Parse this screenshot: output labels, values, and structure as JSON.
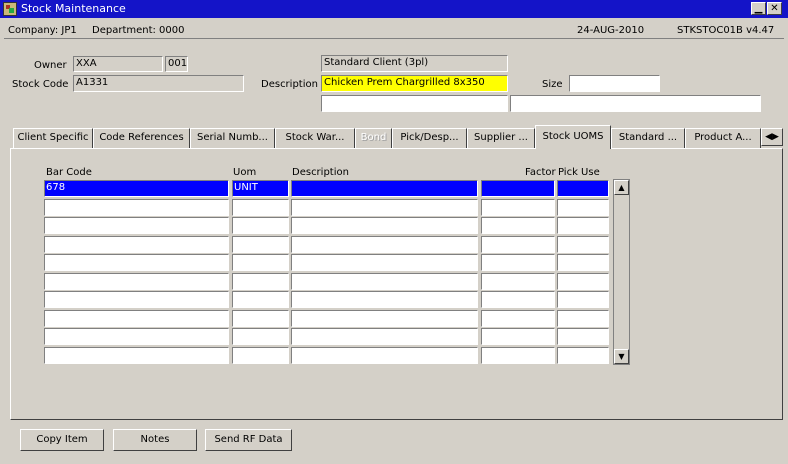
{
  "window": {
    "title": "Stock Maintenance",
    "minimize": "▁",
    "close": "✕"
  },
  "header": {
    "company": "Company:  JP1",
    "department": "Department:  0000",
    "date": "24-AUG-2010",
    "program": "STKSTOC01B  v4.47"
  },
  "form": {
    "owner_label": "Owner",
    "owner_code": "XXA",
    "owner_num": "001",
    "client_name": "Standard Client (3pl)",
    "stock_code_label": "Stock Code",
    "stock_code": "A1331",
    "description_label": "Description",
    "description": "Chicken Prem Chargrilled 8x350",
    "size_label": "Size",
    "size": "",
    "extra1": "",
    "extra2": ""
  },
  "tabs": [
    {
      "label": "Client Specific"
    },
    {
      "label": "Code References"
    },
    {
      "label": "Serial Numb..."
    },
    {
      "label": "Stock War..."
    },
    {
      "label": "Bond"
    },
    {
      "label": "Pick/Desp..."
    },
    {
      "label": "Supplier ..."
    },
    {
      "label": "Stock UOMS"
    },
    {
      "label": "Standard ..."
    },
    {
      "label": "Product A..."
    }
  ],
  "tab_scroll_icon": "◀▶",
  "grid": {
    "columns": {
      "bar_code": "Bar Code",
      "uom": "Uom",
      "description": "Description",
      "factor": "Factor",
      "pick_use": "Pick Use"
    },
    "rows": [
      {
        "bar_code": "678",
        "uom": "UNIT",
        "description": "",
        "factor": "",
        "pick_use": ""
      },
      {
        "bar_code": "",
        "uom": "",
        "description": "",
        "factor": "",
        "pick_use": ""
      },
      {
        "bar_code": "",
        "uom": "",
        "description": "",
        "factor": "",
        "pick_use": ""
      },
      {
        "bar_code": "",
        "uom": "",
        "description": "",
        "factor": "",
        "pick_use": ""
      },
      {
        "bar_code": "",
        "uom": "",
        "description": "",
        "factor": "",
        "pick_use": ""
      },
      {
        "bar_code": "",
        "uom": "",
        "description": "",
        "factor": "",
        "pick_use": ""
      },
      {
        "bar_code": "",
        "uom": "",
        "description": "",
        "factor": "",
        "pick_use": ""
      },
      {
        "bar_code": "",
        "uom": "",
        "description": "",
        "factor": "",
        "pick_use": ""
      },
      {
        "bar_code": "",
        "uom": "",
        "description": "",
        "factor": "",
        "pick_use": ""
      },
      {
        "bar_code": "",
        "uom": "",
        "description": "",
        "factor": "",
        "pick_use": ""
      }
    ],
    "scroll_up": "▲",
    "scroll_down": "▼"
  },
  "buttons": {
    "copy_item": "Copy Item",
    "notes": "Notes",
    "send_rf": "Send RF Data"
  },
  "colors": {
    "title_bar": "#1414c8",
    "selection": "#0000ff",
    "highlight_field": "#ffff00",
    "face": "#d4d0c8"
  }
}
